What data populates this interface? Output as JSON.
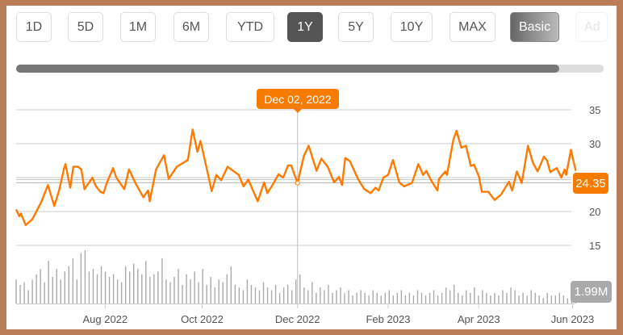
{
  "range_buttons": [
    {
      "label": "1D"
    },
    {
      "label": "5D"
    },
    {
      "label": "1M"
    },
    {
      "label": "6M"
    },
    {
      "label": "YTD"
    },
    {
      "label": "1Y",
      "active": true
    },
    {
      "label": "5Y"
    },
    {
      "label": "10Y"
    },
    {
      "label": "MAX"
    }
  ],
  "mode_buttons": [
    {
      "label": "Basic",
      "active": true
    },
    {
      "label": "Ad"
    }
  ],
  "scroll": {
    "visible_fraction": 0.925
  },
  "tooltip": {
    "date": "Dec 02, 2022"
  },
  "last_price": "24.35",
  "last_volume": "1.99M",
  "colors": {
    "line": "#ff7a00",
    "accent": "#f57c00",
    "grid": "#dddddd"
  },
  "chart_data": {
    "type": "line",
    "x_unit": "days since 2022-06-06",
    "y_ticks": [
      15,
      20,
      25,
      30,
      35
    ],
    "y_tick_labels": [
      "15",
      "20",
      "",
      "30",
      "35"
    ],
    "ylim": [
      15,
      35
    ],
    "x_ticks": [
      {
        "day": 56,
        "label": "Aug 2022"
      },
      {
        "day": 117,
        "label": "Oct 2022"
      },
      {
        "day": 177,
        "label": "Dec 2022"
      },
      {
        "day": 234,
        "label": "Feb 2023"
      },
      {
        "day": 291,
        "label": "Apr 2023"
      },
      {
        "day": 350,
        "label": "Jun 2023"
      }
    ],
    "crosshair_day": 177,
    "price": [
      [
        0,
        20.3
      ],
      [
        2,
        19.3
      ],
      [
        3,
        19.7
      ],
      [
        6,
        18
      ],
      [
        10,
        18.8
      ],
      [
        13,
        20.1
      ],
      [
        16,
        21.5
      ],
      [
        20,
        23.9
      ],
      [
        24,
        20.8
      ],
      [
        27,
        23.1
      ],
      [
        30,
        26.2
      ],
      [
        31,
        27
      ],
      [
        34,
        23.5
      ],
      [
        36,
        26.6
      ],
      [
        39,
        26.6
      ],
      [
        41,
        26.2
      ],
      [
        43,
        23.3
      ],
      [
        48,
        25
      ],
      [
        50,
        23.8
      ],
      [
        53,
        22.9
      ],
      [
        55,
        22.7
      ],
      [
        57,
        24.2
      ],
      [
        61,
        26.4
      ],
      [
        63,
        25
      ],
      [
        68,
        23.3
      ],
      [
        71,
        26.2
      ],
      [
        75,
        24.2
      ],
      [
        80,
        22.1
      ],
      [
        83,
        23.1
      ],
      [
        84,
        21.5
      ],
      [
        88,
        26.2
      ],
      [
        93,
        28.3
      ],
      [
        96,
        24.8
      ],
      [
        101,
        26.6
      ],
      [
        108,
        27.6
      ],
      [
        111,
        32.1
      ],
      [
        114,
        28.8
      ],
      [
        116,
        30.4
      ],
      [
        120,
        26.2
      ],
      [
        123,
        23
      ],
      [
        126,
        25.4
      ],
      [
        129,
        24.6
      ],
      [
        133,
        26.6
      ],
      [
        140,
        25.4
      ],
      [
        143,
        23.7
      ],
      [
        146,
        24.7
      ],
      [
        152,
        21.5
      ],
      [
        156,
        24.3
      ],
      [
        158,
        22.7
      ],
      [
        161,
        23.8
      ],
      [
        165,
        25.5
      ],
      [
        168,
        25
      ],
      [
        171,
        26.8
      ],
      [
        173,
        26.8
      ],
      [
        177,
        24.2
      ],
      [
        181,
        28.2
      ],
      [
        184,
        29.7
      ],
      [
        189,
        26
      ],
      [
        192,
        27.8
      ],
      [
        196,
        26.6
      ],
      [
        200,
        24.3
      ],
      [
        203,
        25.1
      ],
      [
        205,
        23.9
      ],
      [
        207,
        27.9
      ],
      [
        210,
        27.4
      ],
      [
        215,
        24.8
      ],
      [
        219,
        23.3
      ],
      [
        223,
        22.7
      ],
      [
        226,
        23.5
      ],
      [
        228,
        23.1
      ],
      [
        231,
        25
      ],
      [
        234,
        25.4
      ],
      [
        237,
        27.6
      ],
      [
        241,
        24.3
      ],
      [
        244,
        23.7
      ],
      [
        249,
        24.2
      ],
      [
        253,
        27
      ],
      [
        256,
        25.4
      ],
      [
        258,
        26
      ],
      [
        261,
        24.6
      ],
      [
        265,
        23.1
      ],
      [
        266,
        24.8
      ],
      [
        270,
        25.9
      ],
      [
        271,
        25.4
      ],
      [
        275,
        30.6
      ],
      [
        277,
        31.9
      ],
      [
        280,
        29.4
      ],
      [
        283,
        29.7
      ],
      [
        286,
        26.7
      ],
      [
        288,
        26.9
      ],
      [
        291,
        25.2
      ],
      [
        293,
        22.9
      ],
      [
        297,
        22.9
      ],
      [
        301,
        21.7
      ],
      [
        305,
        22.5
      ],
      [
        310,
        24.4
      ],
      [
        312,
        23.1
      ],
      [
        315,
        25.9
      ],
      [
        318,
        24.2
      ],
      [
        322,
        29.7
      ],
      [
        325,
        27.2
      ],
      [
        328,
        25.9
      ],
      [
        332,
        28.1
      ],
      [
        334,
        27.5
      ],
      [
        336,
        25.8
      ],
      [
        340,
        26.4
      ],
      [
        343,
        25
      ],
      [
        345,
        26.2
      ],
      [
        346,
        25.4
      ],
      [
        349,
        29.1
      ],
      [
        352,
        26
      ]
    ],
    "volume_millions": [
      9,
      7,
      8,
      5,
      9,
      11,
      13,
      8,
      16,
      10,
      13,
      9,
      12,
      14,
      17,
      9,
      19,
      20,
      12,
      13,
      11,
      14,
      12,
      10,
      11,
      9,
      8,
      14,
      12,
      15,
      13,
      11,
      16,
      10,
      11,
      12,
      17,
      9,
      8,
      10,
      13,
      7,
      11,
      9,
      12,
      8,
      13,
      7,
      10,
      6,
      9,
      8,
      11,
      14,
      7,
      6,
      5,
      9,
      7,
      6,
      5,
      8,
      6,
      5,
      7,
      4,
      6,
      7,
      5,
      9,
      11,
      6,
      5,
      8,
      4,
      6,
      5,
      7,
      4,
      5,
      6,
      4,
      5,
      3,
      4,
      5,
      4,
      3,
      5,
      4,
      3,
      4,
      5,
      3,
      4,
      5,
      3,
      4,
      3,
      5,
      4,
      3,
      4,
      5,
      3,
      4,
      6,
      5,
      7,
      4,
      3,
      5,
      4,
      6,
      3,
      5,
      4,
      3,
      4,
      3,
      5,
      4,
      6,
      5,
      3,
      4,
      3,
      5,
      4,
      3,
      2,
      4,
      3,
      3,
      4,
      3,
      2,
      3,
      2
    ]
  }
}
